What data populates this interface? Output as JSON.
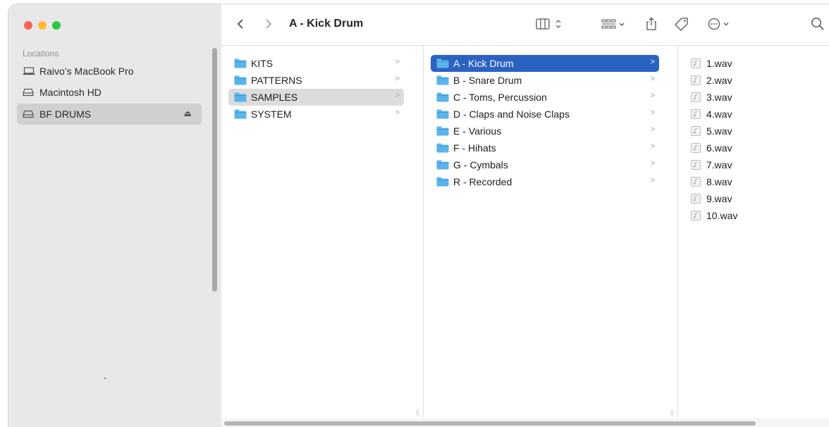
{
  "window": {
    "title": "A - Kick Drum"
  },
  "colors": {
    "close": "#ff5f57",
    "minimize": "#febc2e",
    "zoom": "#28c840",
    "accent": "#2b63c2",
    "folder": "#5ab4ea"
  },
  "sidebar": {
    "heading": "Locations",
    "items": [
      {
        "label": "Raivo’s MacBook Pro",
        "icon": "laptop-icon"
      },
      {
        "label": "Macintosh HD",
        "icon": "drive-icon"
      },
      {
        "label": "BF DRUMS",
        "icon": "drive-icon",
        "selected": true,
        "eject": "⏏"
      }
    ]
  },
  "toolbar": {
    "back": "back-icon",
    "forward": "forward-icon",
    "view": "column-view-icon",
    "group": "group-icon",
    "share": "share-icon",
    "tag": "tag-icon",
    "more": "more-icon",
    "search": "search-icon"
  },
  "columns": {
    "root": [
      {
        "label": "KITS"
      },
      {
        "label": "PATTERNS"
      },
      {
        "label": "SAMPLES",
        "selected": true
      },
      {
        "label": "SYSTEM"
      }
    ],
    "samples": [
      {
        "label": "A - Kick Drum",
        "selected": true
      },
      {
        "label": "B - Snare Drum"
      },
      {
        "label": "C - Toms, Percussion"
      },
      {
        "label": "D - Claps and Noise Claps"
      },
      {
        "label": "E - Various"
      },
      {
        "label": "F - Hihats"
      },
      {
        "label": "G - Cymbals"
      },
      {
        "label": "R - Recorded"
      }
    ],
    "files": [
      {
        "label": "1.wav"
      },
      {
        "label": "2.wav"
      },
      {
        "label": "3.wav"
      },
      {
        "label": "4.wav"
      },
      {
        "label": "5.wav"
      },
      {
        "label": "6.wav"
      },
      {
        "label": "7.wav"
      },
      {
        "label": "8.wav"
      },
      {
        "label": "9.wav"
      },
      {
        "label": "10.wav"
      }
    ]
  }
}
